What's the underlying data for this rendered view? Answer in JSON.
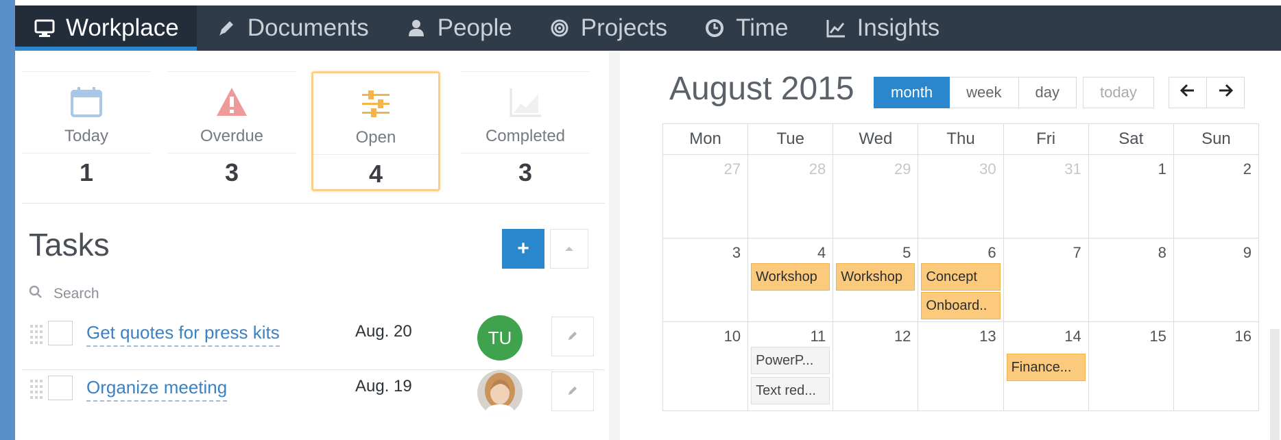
{
  "nav": {
    "items": [
      {
        "label": "Workplace",
        "icon": "monitor-icon",
        "active": true
      },
      {
        "label": "Documents",
        "icon": "pencil-icon",
        "active": false
      },
      {
        "label": "People",
        "icon": "user-icon",
        "active": false
      },
      {
        "label": "Projects",
        "icon": "target-icon",
        "active": false
      },
      {
        "label": "Time",
        "icon": "clock-icon",
        "active": false
      },
      {
        "label": "Insights",
        "icon": "line-chart-icon",
        "active": false
      }
    ]
  },
  "stats": [
    {
      "label": "Today",
      "value": "1",
      "icon": "calendar-icon",
      "color": "#a9c8e8"
    },
    {
      "label": "Overdue",
      "value": "3",
      "icon": "warning-icon",
      "color": "#ef9a9a"
    },
    {
      "label": "Open",
      "value": "4",
      "icon": "sliders-icon",
      "color": "#f5b44a"
    },
    {
      "label": "Completed",
      "value": "3",
      "icon": "area-chart-icon",
      "color": "#e3e6ea"
    }
  ],
  "tasks": {
    "title": "Tasks",
    "add_label": "+",
    "search_placeholder": "Search",
    "items": [
      {
        "title": "Get quotes for press kits",
        "due": "Aug. 20",
        "assignee_initials": "TU",
        "assignee_color": "#3fa34d"
      },
      {
        "title": "Organize meeting",
        "due": "Aug. 19",
        "assignee_initials": "",
        "assignee_color": ""
      }
    ]
  },
  "calendar": {
    "title": "August 2015",
    "views": [
      "month",
      "week",
      "day"
    ],
    "active_view": "month",
    "today_label": "today",
    "weekdays": [
      "Mon",
      "Tue",
      "Wed",
      "Thu",
      "Fri",
      "Sat",
      "Sun"
    ],
    "weeks": [
      [
        {
          "n": "27",
          "other": true
        },
        {
          "n": "28",
          "other": true
        },
        {
          "n": "29",
          "other": true
        },
        {
          "n": "30",
          "other": true
        },
        {
          "n": "31",
          "other": true
        },
        {
          "n": "1"
        },
        {
          "n": "2"
        }
      ],
      [
        {
          "n": "3"
        },
        {
          "n": "4",
          "events": [
            "Workshop"
          ]
        },
        {
          "n": "5",
          "events": [
            "Workshop"
          ]
        },
        {
          "n": "6",
          "events": [
            "Concept",
            "Onboard.."
          ]
        },
        {
          "n": "7"
        },
        {
          "n": "8"
        },
        {
          "n": "9"
        }
      ],
      [
        {
          "n": "10"
        },
        {
          "n": "11",
          "events": [
            "PowerP...",
            "Text red..."
          ],
          "grey": true
        },
        {
          "n": "12"
        },
        {
          "n": "13"
        },
        {
          "n": "14",
          "events": [
            "Finance..."
          ]
        },
        {
          "n": "15"
        },
        {
          "n": "16"
        }
      ]
    ],
    "event_color": "#fcca7d",
    "accent": "#2a86cd"
  }
}
